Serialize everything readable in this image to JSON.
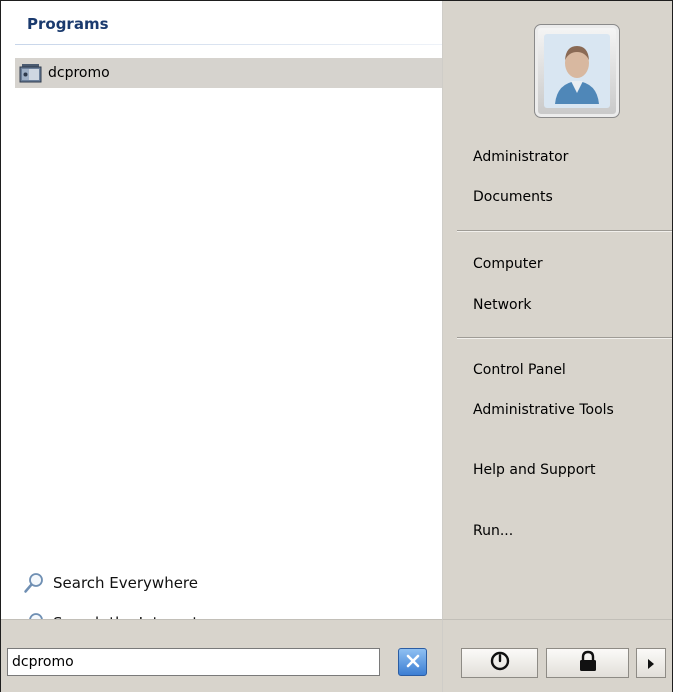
{
  "programs": {
    "header": "Programs",
    "items": [
      {
        "label": "dcpromo",
        "icon": "dcpromo-app-icon"
      }
    ]
  },
  "search_links": {
    "everywhere": "Search Everywhere",
    "internet": "Search the Internet"
  },
  "search_box": {
    "value": "dcpromo"
  },
  "right_pane": {
    "user_picture_icon": "user-avatar-icon",
    "items": [
      {
        "label": "Administrator"
      },
      {
        "label": "Documents"
      },
      {
        "label": "Computer"
      },
      {
        "label": "Network"
      },
      {
        "label": "Control Panel"
      },
      {
        "label": "Administrative Tools"
      },
      {
        "label": "Help and Support"
      },
      {
        "label": "Run..."
      }
    ]
  },
  "bottom_buttons": {
    "power_icon": "power-icon",
    "lock_icon": "lock-icon",
    "arrow_icon": "arrow-right-icon",
    "clear_icon": "clear-x-icon"
  },
  "colors": {
    "right_pane_bg": "#d8d4cc",
    "selected_item_bg": "#d6d3ce",
    "programs_header": "#1a3a6e",
    "clear_button": "#3c7ed3"
  }
}
